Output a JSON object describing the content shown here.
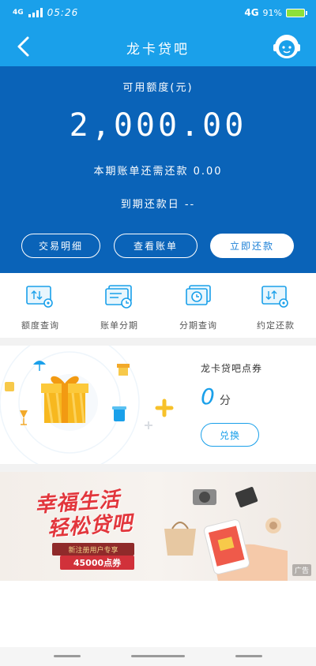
{
  "status": {
    "network_small": "4G",
    "time": "05:26",
    "network": "4G",
    "battery": "91%"
  },
  "header": {
    "title": "龙卡贷吧",
    "back_icon": "chevron-left-icon",
    "service_icon": "customer-service-icon"
  },
  "credit": {
    "label": "可用额度(元)",
    "amount": "2,000.00",
    "due_text": "本期账单还需还款 0.00",
    "repay_date_text": "到期还款日 --",
    "buttons": {
      "details": "交易明细",
      "bill": "查看账单",
      "repay": "立即还款"
    }
  },
  "quick_menu": [
    {
      "label": "额度查询",
      "icon": "quota-query-icon"
    },
    {
      "label": "账单分期",
      "icon": "bill-installment-icon"
    },
    {
      "label": "分期查询",
      "icon": "installment-query-icon"
    },
    {
      "label": "约定还款",
      "icon": "scheduled-repay-icon"
    }
  ],
  "coupon": {
    "title": "龙卡贷吧点券",
    "points_value": "0",
    "points_unit": "分",
    "redeem_label": "兑换"
  },
  "banner": {
    "title_line1": "幸福生活",
    "title_line2": "轻松贷吧",
    "tag_line1": "新注册用户专享",
    "tag_line2": "45000点券",
    "ad_label": "广告"
  },
  "colors": {
    "header_blue": "#1aa0ea",
    "panel_blue": "#0a63b8",
    "accent_red": "#e2363c"
  }
}
